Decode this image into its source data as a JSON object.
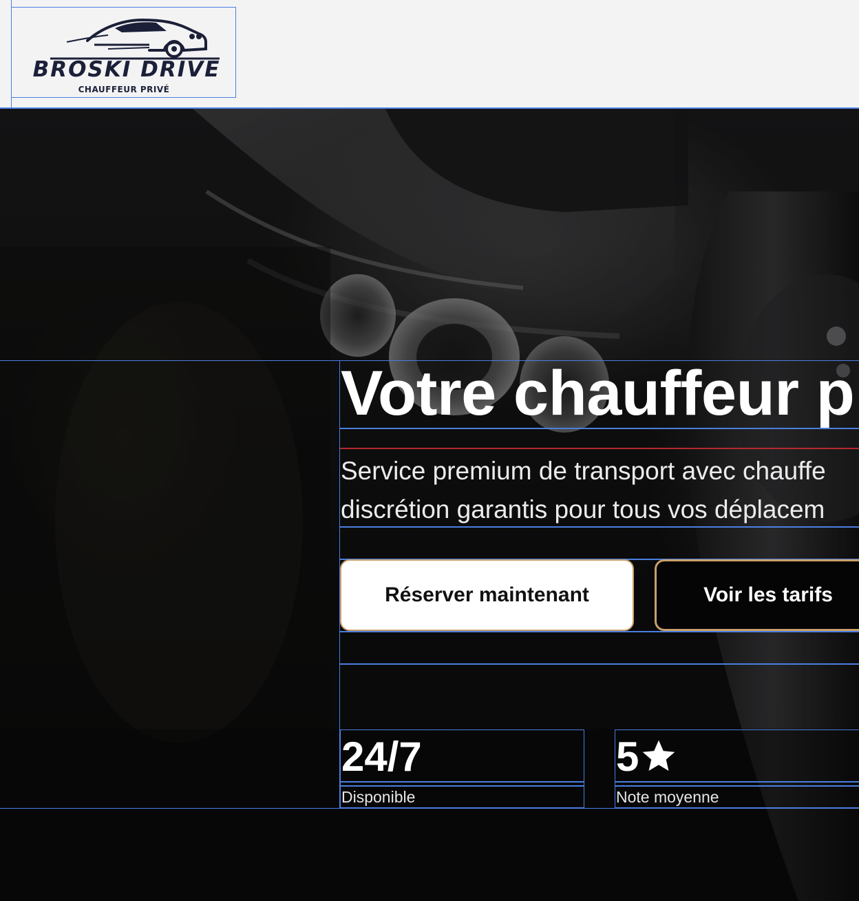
{
  "brand": {
    "name": "BROSKI DRIVE",
    "tagline": "CHAUFFEUR PRIVÉ",
    "logo_icon": "car-silhouette-icon"
  },
  "hero": {
    "title": "Votre chauffeur p",
    "subtitle_lines": [
      "Service premium de transport avec chauffe",
      "discrétion garantis pour tous vos déplacem"
    ],
    "buttons": {
      "primary_label": "Réserver maintenant",
      "secondary_label": "Voir les tarifs"
    },
    "stats": [
      {
        "value": "24/7",
        "label": "Disponible"
      },
      {
        "value": "5",
        "icon": "star-icon",
        "label": "Note moyenne"
      }
    ]
  },
  "colors": {
    "header_bg": "#f3f3f4",
    "brand_navy": "#1b2038",
    "accent_gold": "#c9a06a",
    "accent_red": "#b8282f",
    "guide_blue": "#4a7fe0",
    "hero_text": "#ffffff"
  }
}
